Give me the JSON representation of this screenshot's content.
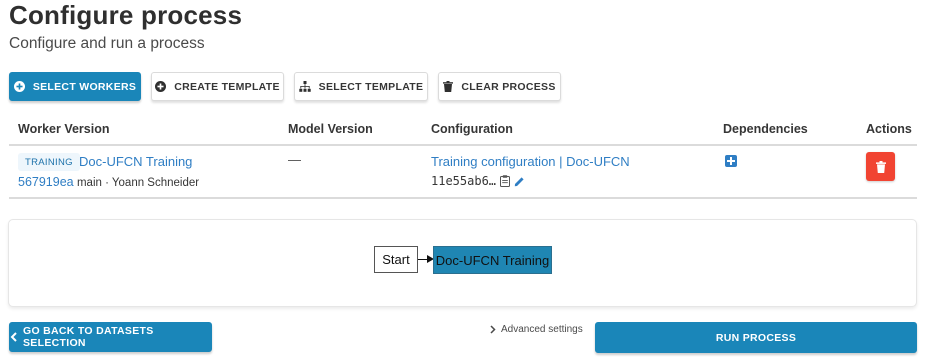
{
  "page": {
    "title": "Configure process",
    "subtitle": "Configure and run a process"
  },
  "toolbar": {
    "select_workers": "SELECT WORKERS",
    "create_template": "CREATE TEMPLATE",
    "select_template": "SELECT TEMPLATE",
    "clear_process": "CLEAR PROCESS"
  },
  "table": {
    "headers": {
      "worker_version": "Worker Version",
      "model_version": "Model Version",
      "configuration": "Configuration",
      "dependencies": "Dependencies",
      "actions": "Actions"
    },
    "rows": [
      {
        "tag": "TRAINING",
        "worker_name": "Doc-UFCN Training",
        "revision": "567919ea",
        "branch_author": "main · Yoann Schneider",
        "model_version": "—",
        "configuration_name": "Training configuration | Doc-UFCN",
        "configuration_hash": "11e55ab6…"
      }
    ]
  },
  "graph": {
    "start_label": "Start",
    "worker_label": "Doc-UFCN Training"
  },
  "footer": {
    "back_label": "GO BACK TO DATASETS SELECTION",
    "advanced_settings": "Advanced settings",
    "run_label": "RUN PROCESS"
  },
  "colors": {
    "primary": "#1a86b9",
    "link": "#2f7ec4",
    "danger": "#f14432",
    "tag_bg": "#eef6fc"
  },
  "icons": {
    "select_workers": "plus-circle-icon",
    "create_template": "plus-circle-icon",
    "select_template": "sitemap-icon",
    "clear_process": "trash-icon",
    "copy": "clipboard-icon",
    "edit": "pencil-icon",
    "dependency": "plus-square-icon",
    "delete": "trash-icon",
    "back": "chevron-left-icon",
    "advanced": "chevron-right-icon"
  }
}
